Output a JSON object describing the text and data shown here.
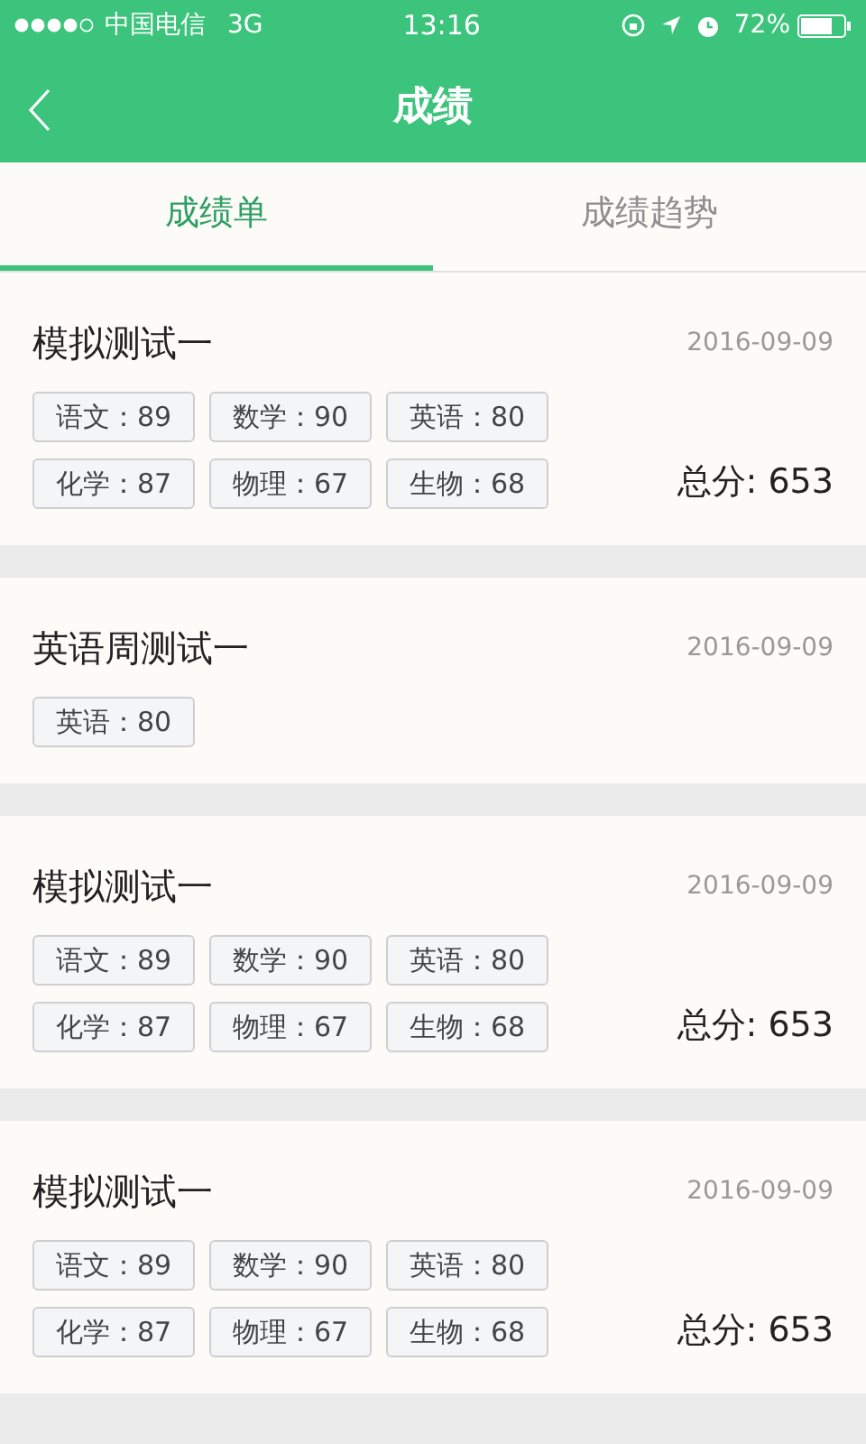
{
  "status_bar": {
    "carrier": "中国电信",
    "network": "3G",
    "time": "13:16",
    "battery": "72%"
  },
  "nav": {
    "title": "成绩"
  },
  "tabs": [
    {
      "label": "成绩单",
      "selected": true
    },
    {
      "label": "成绩趋势",
      "selected": false
    }
  ],
  "exams": [
    {
      "title": "模拟测试一",
      "date": "2016-09-09",
      "scores": [
        "语文：89",
        "数学：90",
        "英语：80",
        "化学：87",
        "物理：67",
        "生物：68"
      ],
      "total": "总分: 653"
    },
    {
      "title": "英语周测试一",
      "date": "2016-09-09",
      "scores": [
        "英语：80"
      ]
    },
    {
      "title": "模拟测试一",
      "date": "2016-09-09",
      "scores": [
        "语文：89",
        "数学：90",
        "英语：80",
        "化学：87",
        "物理：67",
        "生物：68"
      ],
      "total": "总分: 653"
    },
    {
      "title": "模拟测试一",
      "date": "2016-09-09",
      "scores": [
        "语文：89",
        "数学：90",
        "英语：80",
        "化学：87",
        "物理：67",
        "生物：68"
      ],
      "total": "总分: 653"
    }
  ]
}
